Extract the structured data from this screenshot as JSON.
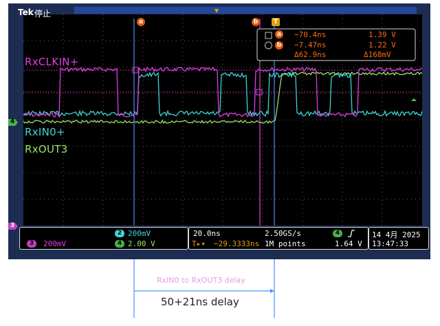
{
  "topbar": {
    "brand": "Tek",
    "status": "停止"
  },
  "traces": {
    "clk": {
      "label": "RxCLKIN+",
      "color": "#e040e0"
    },
    "in0": {
      "label": "RxIN0+",
      "color": "#3ed6d6"
    },
    "out3": {
      "label": "RxOUT3",
      "color": "#9de36a"
    }
  },
  "cursor_markers": {
    "a": "a",
    "b": "b",
    "trigger": "T"
  },
  "channel_markers": {
    "ch3": "3",
    "ch4": "4"
  },
  "measurement": {
    "a_time": "−70.4ns",
    "a_volt": "1.39 V",
    "b_time": "−7.47ns",
    "b_volt": "1.22 V",
    "delta_time": "Δ62.9ns",
    "delta_volt": "Δ168mV"
  },
  "bottom": {
    "ch2_num": "2",
    "ch2_scale": "200mV",
    "ch3_num": "3",
    "ch3_scale": "200mV",
    "ch4_num": "4",
    "ch4_scale": "2.00 V",
    "timebase": "20.0ns",
    "sample_rate": "2.50GS/s",
    "position_icon": "T▸▾",
    "position": "−29.3333ns",
    "record_length": "1M points",
    "trig_ch": "4",
    "trig_slope_icon": "rising-edge-icon",
    "trig_level": "1.64 V",
    "date": "14 4月  2025",
    "time": "13:47:33"
  },
  "annotation": {
    "small": "RxIN0 to RxOUT3 delay",
    "big": "50+21ns delay"
  },
  "colors": {
    "background": "#1d2d52",
    "grid": "#000000",
    "cursor": "#4a90ff",
    "orange": "#e35a0c"
  }
}
